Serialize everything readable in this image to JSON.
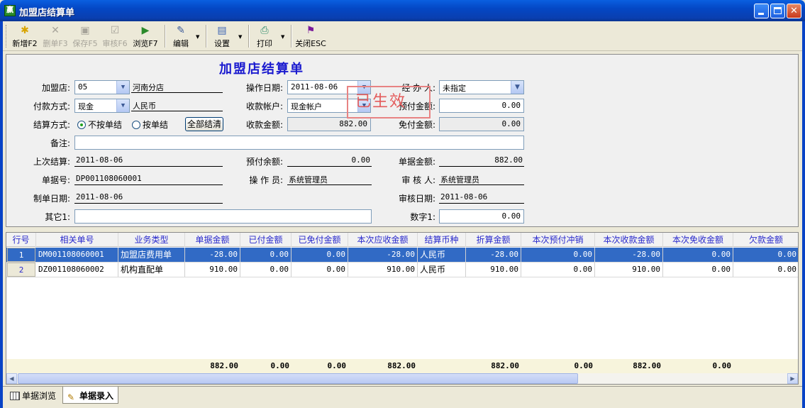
{
  "window": {
    "title": "加盟店结算单",
    "app_icon_text": "赢",
    "controls": [
      "minimize-icon",
      "maximize-icon",
      "close-icon"
    ]
  },
  "toolbar": {
    "buttons": [
      {
        "label": "新增F2",
        "icon": "new-doc-icon",
        "enabled": true
      },
      {
        "label": "删单F3",
        "icon": "delete-icon",
        "enabled": false
      },
      {
        "label": "保存F5",
        "icon": "save-icon",
        "enabled": false
      },
      {
        "label": "审核F6",
        "icon": "audit-icon",
        "enabled": false
      },
      {
        "label": "浏览F7",
        "icon": "browse-icon",
        "enabled": true
      },
      {
        "label": "编辑",
        "icon": "edit-icon",
        "enabled": true
      },
      {
        "label": "设置",
        "icon": "settings-icon",
        "enabled": true
      },
      {
        "label": "打印",
        "icon": "printer-icon",
        "enabled": true
      },
      {
        "label": "关闭ESC",
        "icon": "close-door-icon",
        "enabled": true
      }
    ]
  },
  "form": {
    "title": "加盟店结算单",
    "stamp": "已生效",
    "store_label": "加盟店:",
    "store_code": "05",
    "store_name": "河南分店",
    "pay_method_label": "付款方式:",
    "pay_method": "现金",
    "currency": "人民币",
    "settle_method_label": "结算方式:",
    "settle_option_a": "不按单结",
    "settle_option_b": "按单结",
    "settle_all_button": "全部结清",
    "note_label": "备注:",
    "note": "",
    "last_settle_label": "上次结算:",
    "last_settle": "2011-08-06",
    "doc_no_label": "单据号:",
    "doc_no": "DP001108060001",
    "made_date_label": "制单日期:",
    "made_date": "2011-08-06",
    "other_label": "其它1:",
    "other": "",
    "op_date_label": "操作日期:",
    "op_date": "2011-08-06",
    "account_label": "收款帐户:",
    "account": "现金帐户",
    "receipt_amount_label": "收款金额:",
    "receipt_amount": "882.00",
    "prepay_balance_label": "预付余额:",
    "prepay_balance": "0.00",
    "operator_label": "操 作 员:",
    "operator": "系统管理员",
    "handler_label": "经 办 人:",
    "handler": "未指定",
    "prepay_amount_label": "预付金额:",
    "prepay_amount": "0.00",
    "exempt_amount_label": "免付金额:",
    "exempt_amount": "0.00",
    "doc_amount_label": "单据金额:",
    "doc_amount": "882.00",
    "auditor_label": "审 核 人:",
    "auditor": "系统管理员",
    "audit_date_label": "审核日期:",
    "audit_date": "2011-08-06",
    "number1_label": "数字1:",
    "number1": "0.00"
  },
  "grid": {
    "headers": [
      "行号",
      "相关单号",
      "业务类型",
      "单据金额",
      "已付金额",
      "已免付金额",
      "本次应收金额",
      "结算币种",
      "折算金额",
      "本次预付冲销",
      "本次收款金额",
      "本次免收金额",
      "欠款金额"
    ],
    "rows": [
      [
        "1",
        "DM001108060001",
        "加盟店费用单",
        "-28.00",
        "0.00",
        "0.00",
        "-28.00",
        "人民币",
        "-28.00",
        "0.00",
        "-28.00",
        "0.00",
        "0.00"
      ],
      [
        "2",
        "DZ001108060002",
        "机构直配单",
        "910.00",
        "0.00",
        "0.00",
        "910.00",
        "人民币",
        "910.00",
        "0.00",
        "910.00",
        "0.00",
        "0.00"
      ]
    ],
    "selected_row": 0,
    "totals": [
      "",
      "",
      "",
      "882.00",
      "0.00",
      "0.00",
      "882.00",
      "",
      "882.00",
      "0.00",
      "882.00",
      "0.00",
      ""
    ]
  },
  "tabs": [
    {
      "label": "单据浏览",
      "icon": "grid-icon",
      "active": false
    },
    {
      "label": "单据录入",
      "icon": "pencil-icon",
      "active": true
    }
  ]
}
